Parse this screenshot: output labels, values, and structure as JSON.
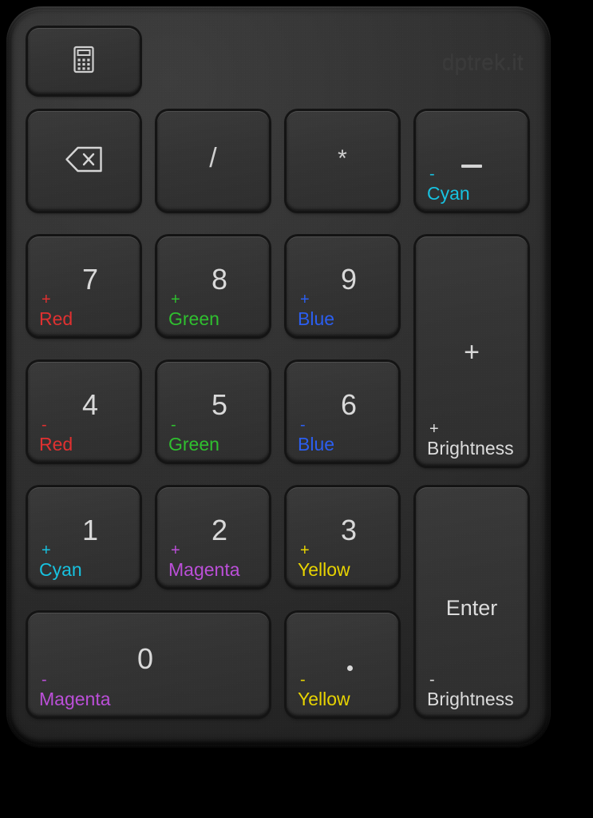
{
  "device": {
    "name": "rgb-numeric-keypad",
    "watermark": "dptrek.it",
    "body_color": "#313131",
    "key_face_color": "#343434"
  },
  "colors": {
    "red": "#e03030",
    "green": "#2fbf2f",
    "blue": "#2b5ef0",
    "cyan": "#17c2e0",
    "magenta": "#bb4fd8",
    "yellow": "#e8d400",
    "white": "#dcdcdc"
  },
  "keys": {
    "calculator": {
      "icon": "calculator-icon",
      "primary": "",
      "sign": "",
      "word": ""
    },
    "backspace": {
      "icon": "backspace-icon",
      "primary": "",
      "sign": "",
      "word": ""
    },
    "divide": {
      "primary": "/",
      "sign": "",
      "word": ""
    },
    "multiply": {
      "primary": "*",
      "sign": "",
      "word": ""
    },
    "minus": {
      "primary": "–",
      "sign": "-",
      "word": "Cyan",
      "word_color": "cyan"
    },
    "seven": {
      "primary": "7",
      "sign": "+",
      "word": "Red",
      "word_color": "red"
    },
    "eight": {
      "primary": "8",
      "sign": "+",
      "word": "Green",
      "word_color": "green"
    },
    "nine": {
      "primary": "9",
      "sign": "+",
      "word": "Blue",
      "word_color": "blue"
    },
    "plus": {
      "primary": "+",
      "sign": "+",
      "word": "Brightness",
      "word_color": "white"
    },
    "four": {
      "primary": "4",
      "sign": "-",
      "word": "Red",
      "word_color": "red"
    },
    "five": {
      "primary": "5",
      "sign": "-",
      "word": "Green",
      "word_color": "green"
    },
    "six": {
      "primary": "6",
      "sign": "-",
      "word": "Blue",
      "word_color": "blue"
    },
    "one": {
      "primary": "1",
      "sign": "+",
      "word": "Cyan",
      "word_color": "cyan"
    },
    "two": {
      "primary": "2",
      "sign": "+",
      "word": "Magenta",
      "word_color": "magenta"
    },
    "three": {
      "primary": "3",
      "sign": "+",
      "word": "Yellow",
      "word_color": "yellow"
    },
    "enter": {
      "primary": "Enter",
      "sign": "-",
      "word": "Brightness",
      "word_color": "white"
    },
    "zero": {
      "primary": "0",
      "sign": "-",
      "word": "Magenta",
      "word_color": "magenta"
    },
    "decimal": {
      "primary": "·",
      "sign": "-",
      "word": "Yellow",
      "word_color": "yellow"
    }
  }
}
